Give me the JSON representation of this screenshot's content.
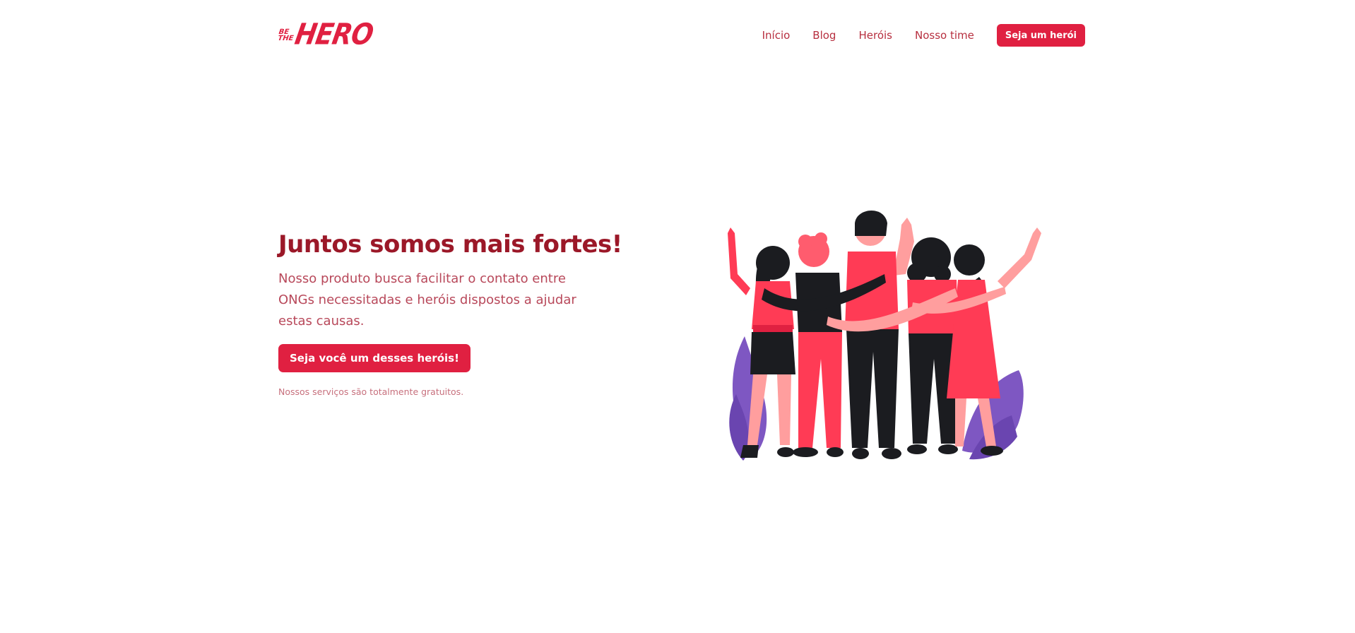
{
  "brand": {
    "logo_small_top": "BE",
    "logo_small_bottom": "THE",
    "logo_big": "HERO",
    "accent": "#e02041",
    "title_color": "#9b1828",
    "text_color": "#b8485a"
  },
  "nav": {
    "items": [
      {
        "label": "Início"
      },
      {
        "label": "Blog"
      },
      {
        "label": "Heróis"
      },
      {
        "label": "Nosso time"
      }
    ],
    "cta_label": "Seja um herói"
  },
  "hero": {
    "title": "Juntos somos mais fortes!",
    "description": "Nosso produto busca facilitar o contato entre ONGs necessitadas e heróis dispostos a ajudar estas causas.",
    "button_label": "Seja você um desses heróis!",
    "note": "Nossos serviços são totalmente gratuitos."
  },
  "illustration": {
    "icon": "group-of-friends-illustration"
  }
}
